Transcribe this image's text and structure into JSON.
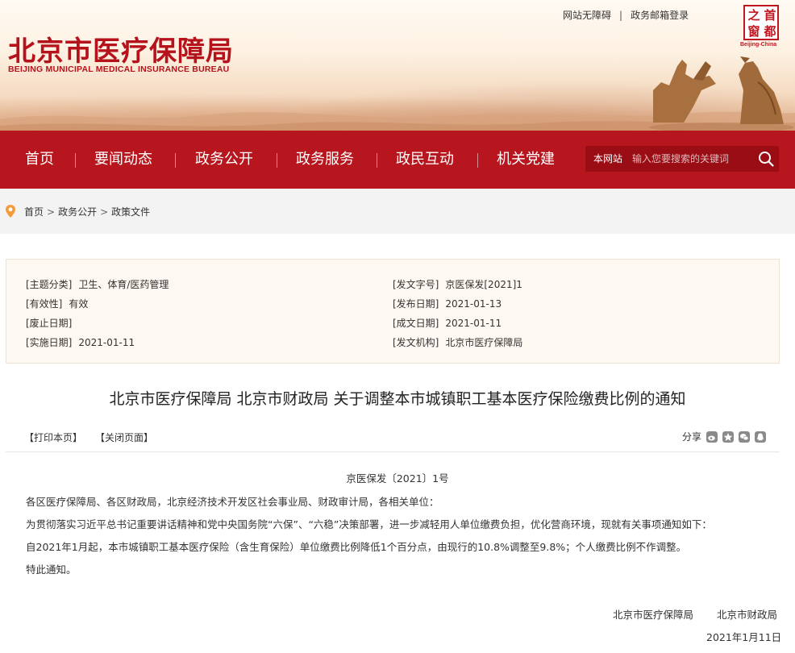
{
  "header": {
    "logo_cn": "北京市医疗保障局",
    "logo_en": "BEIJING MUNICIPAL MEDICAL INSURANCE BUREAU",
    "top_links": [
      "网站无障碍",
      "政务邮箱登录"
    ],
    "seal_chars": [
      "之",
      "首",
      "窗",
      "都"
    ],
    "seal_label": "Beijing-China"
  },
  "nav": {
    "items": [
      "首页",
      "要闻动态",
      "政务公开",
      "政务服务",
      "政民互动",
      "机关党建"
    ],
    "search_scope": "本网站",
    "search_placeholder": "输入您要搜索的关键词"
  },
  "breadcrumb": [
    "首页",
    "政务公开",
    "政策文件"
  ],
  "meta": {
    "left": [
      {
        "k": "[主题分类]",
        "v": "卫生、体育/医药管理"
      },
      {
        "k": "[有效性]",
        "v": "有效"
      },
      {
        "k": "[废止日期]",
        "v": ""
      },
      {
        "k": "[实施日期]",
        "v": "2021-01-11"
      }
    ],
    "right": [
      {
        "k": "[发文字号]",
        "v": "京医保发[2021]1"
      },
      {
        "k": "[发布日期]",
        "v": "2021-01-13"
      },
      {
        "k": "[成文日期]",
        "v": "2021-01-11"
      },
      {
        "k": "[发文机构]",
        "v": "北京市医疗保障局"
      }
    ]
  },
  "article": {
    "title": "北京市医疗保障局 北京市财政局 关于调整本市城镇职工基本医疗保险缴费比例的通知",
    "print_label": "【打印本页】",
    "close_label": "【关闭页面】",
    "share_label": "分享",
    "doc_no": "京医保发〔2021〕1号",
    "paragraphs": [
      "各区医疗保障局、各区财政局，北京经济技术开发区社会事业局、财政审计局，各相关单位：",
      "为贯彻落实习近平总书记重要讲话精神和党中央国务院“六保”、“六稳”决策部署，进一步减轻用人单位缴费负担，优化营商环境，现就有关事项通知如下：",
      "自2021年1月起，本市城镇职工基本医疗保险（含生育保险）单位缴费比例降低1个百分点，由现行的10.8%调整至9.8%；个人缴费比例不作调整。",
      "特此通知。"
    ],
    "signers": [
      "北京市医疗保障局",
      "北京市财政局"
    ],
    "date": "2021年1月11日"
  },
  "colors": {
    "brand_red": "#b8161e",
    "meta_bg": "#fdf8f1",
    "crumb_bg": "#f3f3f3"
  }
}
